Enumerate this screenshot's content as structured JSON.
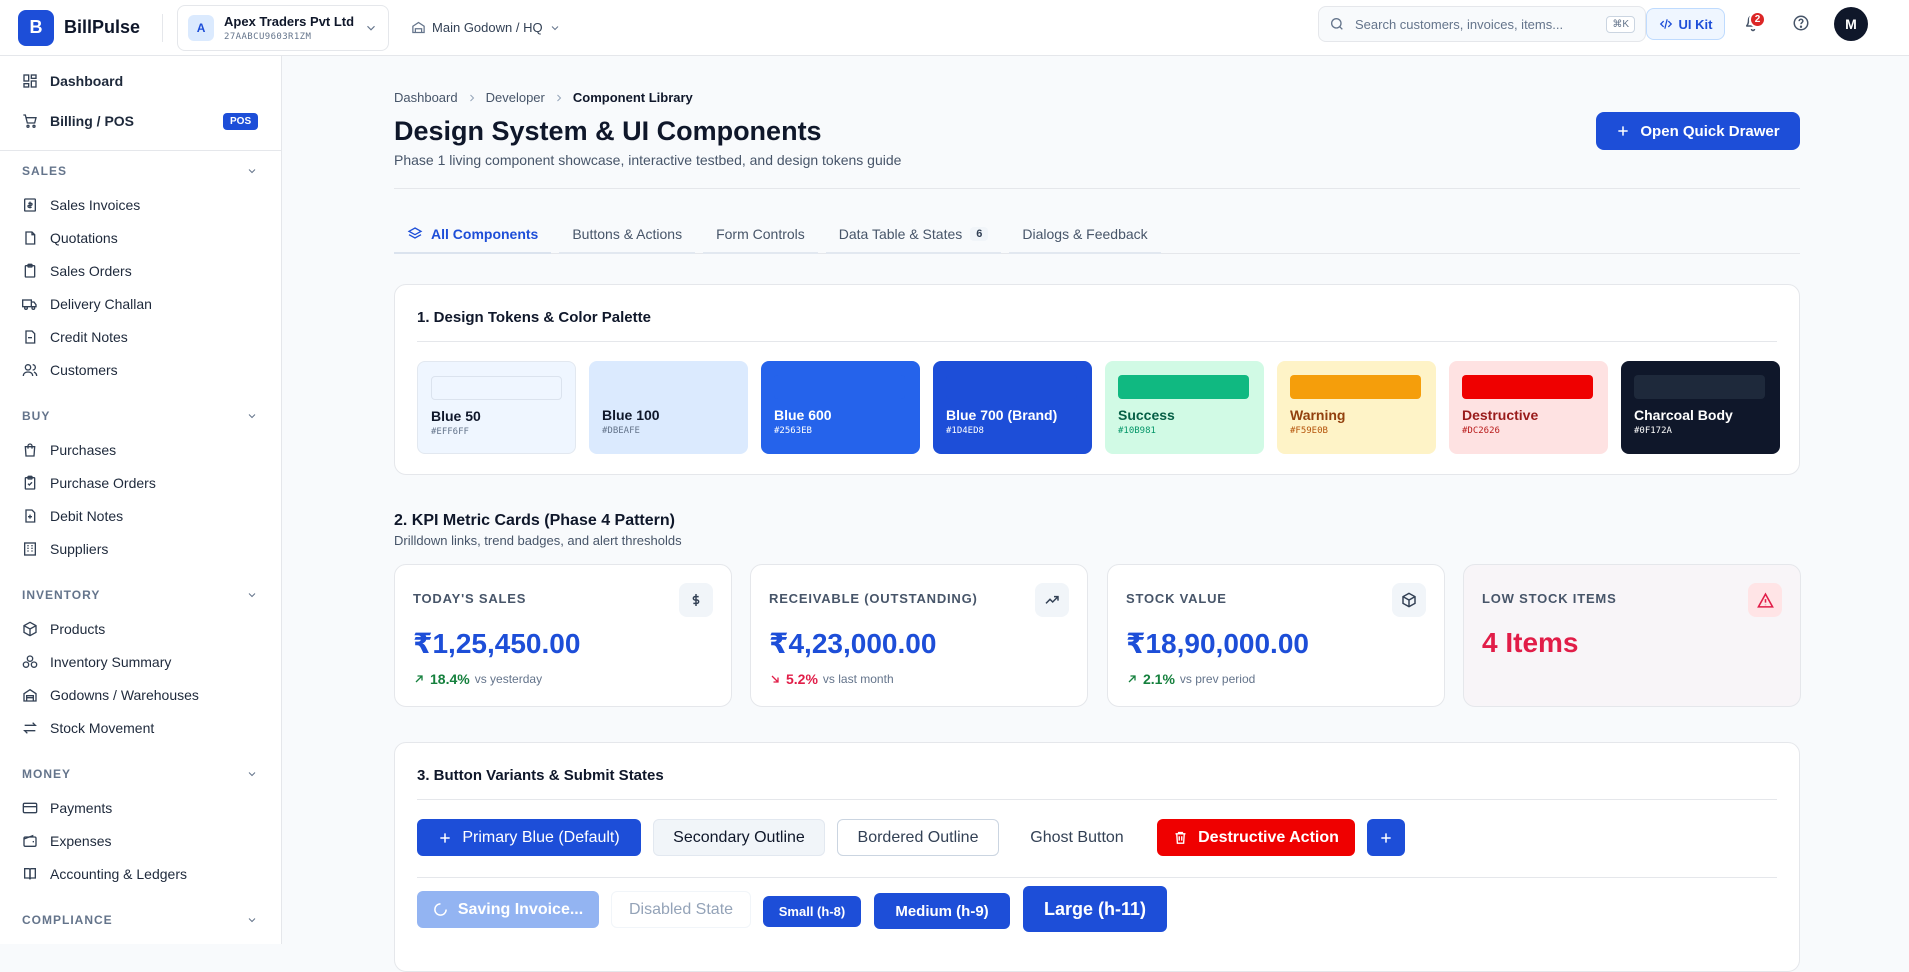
{
  "app": {
    "initial": "B",
    "name": "BillPulse"
  },
  "company": {
    "initial": "A",
    "name": "Apex Traders Pvt Ltd",
    "gstin": "27AABCU9603R1ZM"
  },
  "godown": {
    "label": "Main Godown / HQ"
  },
  "search": {
    "placeholder": "Search customers, invoices, items...",
    "shortcut": "⌘K"
  },
  "header": {
    "uikit_label": "UI Kit",
    "notifications_count": "2",
    "user_initial": "M"
  },
  "sidebar": {
    "top_items": [
      {
        "label": "Dashboard",
        "icon": "dashboard-icon"
      },
      {
        "label": "Billing / POS",
        "icon": "cart-icon",
        "badge": "POS"
      }
    ],
    "sections": [
      {
        "title": "SALES",
        "items": [
          {
            "label": "Sales Invoices",
            "icon": "invoice-icon"
          },
          {
            "label": "Quotations",
            "icon": "document-icon"
          },
          {
            "label": "Sales Orders",
            "icon": "clipboard-icon"
          },
          {
            "label": "Delivery Challan",
            "icon": "truck-icon"
          },
          {
            "label": "Credit Notes",
            "icon": "note-icon"
          },
          {
            "label": "Customers",
            "icon": "users-icon"
          }
        ]
      },
      {
        "title": "BUY",
        "items": [
          {
            "label": "Purchases",
            "icon": "bag-icon"
          },
          {
            "label": "Purchase Orders",
            "icon": "clipboard-icon"
          },
          {
            "label": "Debit Notes",
            "icon": "note-plus-icon"
          },
          {
            "label": "Suppliers",
            "icon": "building-icon"
          }
        ]
      },
      {
        "title": "INVENTORY",
        "items": [
          {
            "label": "Products",
            "icon": "box-icon"
          },
          {
            "label": "Inventory Summary",
            "icon": "boxes-icon"
          },
          {
            "label": "Godowns / Warehouses",
            "icon": "warehouse-icon"
          },
          {
            "label": "Stock Movement",
            "icon": "arrows-icon"
          }
        ]
      },
      {
        "title": "MONEY",
        "items": [
          {
            "label": "Payments",
            "icon": "card-icon"
          },
          {
            "label": "Expenses",
            "icon": "wallet-icon"
          },
          {
            "label": "Accounting & Ledgers",
            "icon": "book-icon"
          }
        ]
      },
      {
        "title": "COMPLIANCE",
        "items": []
      }
    ]
  },
  "breadcrumb": [
    "Dashboard",
    "Developer",
    "Component Library"
  ],
  "page": {
    "title": "Design System & UI Components",
    "subtitle": "Phase 1 living component showcase, interactive testbed, and design tokens guide",
    "quick_button": "Open Quick Drawer"
  },
  "tabs": [
    {
      "label": "All Components",
      "active": true
    },
    {
      "label": "Buttons & Actions"
    },
    {
      "label": "Form Controls"
    },
    {
      "label": "Data Table & States",
      "count": "6"
    },
    {
      "label": "Dialogs & Feedback"
    }
  ],
  "tokens": {
    "title": "1. Design Tokens & Color Palette",
    "swatches": [
      {
        "name": "Blue 50",
        "hex": "#EFF6FF",
        "bg": "#eff6ff",
        "bar": "#eff6ff",
        "text": "#0f172a",
        "hexColor": "#64748b",
        "bordered": true
      },
      {
        "name": "Blue 100",
        "hex": "#DBEAFE",
        "bg": "#dbeafe",
        "bar": "#dbeafe",
        "text": "#0f172a",
        "hexColor": "#64748b"
      },
      {
        "name": "Blue 600",
        "hex": "#2563EB",
        "bg": "#2563eb",
        "bar": "#2563eb",
        "text": "#ffffff",
        "hexColor": "#ffffff"
      },
      {
        "name": "Blue 700 (Brand)",
        "hex": "#1D4ED8",
        "bg": "#1d4ed8",
        "bar": "#1d4ed8",
        "text": "#ffffff",
        "hexColor": "#ffffff"
      },
      {
        "name": "Success",
        "hex": "#10B981",
        "bg": "#d1fae5",
        "bar": "#10b981",
        "text": "#065f46",
        "hexColor": "#059669"
      },
      {
        "name": "Warning",
        "hex": "#F59E0B",
        "bg": "#fef3c7",
        "bar": "#f59e0b",
        "text": "#92400e",
        "hexColor": "#b45309"
      },
      {
        "name": "Destructive",
        "hex": "#DC2626",
        "bg": "#fee2e2",
        "bar": "#ef0000",
        "text": "#991b1b",
        "hexColor": "#b91c1c"
      },
      {
        "name": "Charcoal Body",
        "hex": "#0F172A",
        "bg": "#0f172a",
        "bar": "#1e293b",
        "text": "#ffffff",
        "hexColor": "#ffffff"
      }
    ]
  },
  "kpi": {
    "title": "2. KPI Metric Cards (Phase 4 Pattern)",
    "subtitle": "Drilldown links, trend badges, and alert thresholds",
    "cards": [
      {
        "label": "TODAY'S SALES",
        "value": "₹1,25,450.00",
        "trend": "up",
        "pct": "18.4%",
        "compare": "vs yesterday",
        "icon": "rupee-icon"
      },
      {
        "label": "RECEIVABLE (OUTSTANDING)",
        "value": "₹4,23,000.00",
        "trend": "down",
        "pct": "5.2%",
        "compare": "vs last month",
        "icon": "trending-up-icon"
      },
      {
        "label": "STOCK VALUE",
        "value": "₹18,90,000.00",
        "trend": "up",
        "pct": "2.1%",
        "compare": "vs prev period",
        "icon": "package-icon"
      },
      {
        "label": "LOW STOCK ITEMS",
        "value": "4 Items",
        "alert": true,
        "icon": "alert-triangle-icon"
      }
    ]
  },
  "buttons": {
    "title": "3. Button Variants & Submit States",
    "primary": "Primary Blue (Default)",
    "secondary": "Secondary Outline",
    "bordered": "Bordered Outline",
    "ghost": "Ghost Button",
    "destructive": "Destructive Action",
    "saving": "Saving Invoice...",
    "disabled": "Disabled State",
    "small": "Small (h-8)",
    "medium": "Medium (h-9)",
    "large": "Large (h-11)"
  },
  "colors": {
    "brand": "#1d4ed8",
    "danger": "#e11d48",
    "success": "#15803d"
  }
}
